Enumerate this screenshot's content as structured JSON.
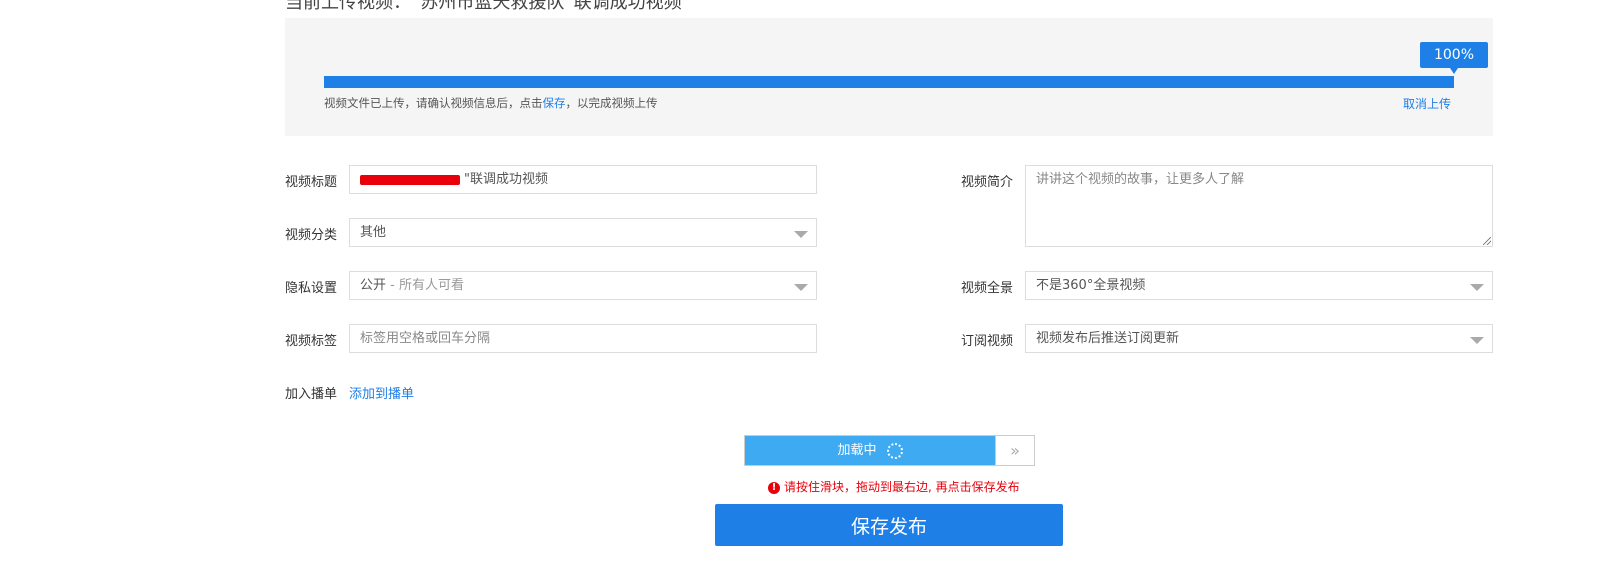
{
  "page": {
    "top_heading_cut": "当前上传视频：“苏州市蓝天救援队”联调成功视频"
  },
  "upload": {
    "progress_percent": 100,
    "badge_text": "100%",
    "note_prefix": "视频文件已上传，请确认视频信息后，点击",
    "note_link": "保存",
    "note_suffix": "，以完成视频上传",
    "cancel_label": "取消上传",
    "accent_color": "#1e7fe6"
  },
  "form": {
    "title": {
      "label": "视频标题",
      "value_suffix": "\"联调成功视频"
    },
    "category": {
      "label": "视频分类",
      "value": "其他"
    },
    "privacy": {
      "label": "隐私设置",
      "value": "公开",
      "hint": " - 所有人可看"
    },
    "tags": {
      "label": "视频标签",
      "placeholder": "标签用空格或回车分隔"
    },
    "playlist": {
      "label": "加入播单",
      "link": "添加到播单"
    },
    "description": {
      "label": "视频简介",
      "placeholder": "讲讲这个视频的故事，让更多人了解"
    },
    "panorama": {
      "label": "视频全景",
      "value": "不是360°全景视频"
    },
    "subscribe": {
      "label": "订阅视频",
      "value": "视频发布后推送订阅更新"
    }
  },
  "captcha": {
    "loading_text": "加载中",
    "handle_icon": "double-chevron-right-icon",
    "handle_glyph": "»",
    "warning_text": "请按住滑块，拖动到最右边, 再点击保存发布",
    "warning_icon": "!"
  },
  "actions": {
    "save_label": "保存发布"
  }
}
